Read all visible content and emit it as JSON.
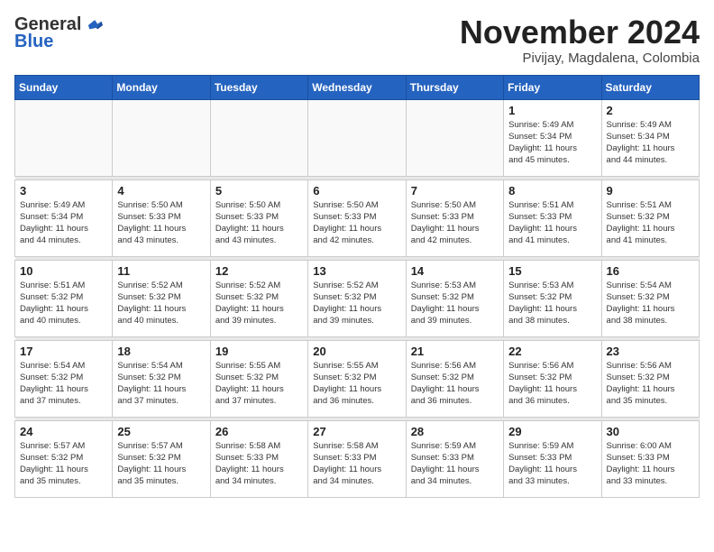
{
  "header": {
    "logo_general": "General",
    "logo_blue": "Blue",
    "month_title": "November 2024",
    "subtitle": "Pivijay, Magdalena, Colombia"
  },
  "days_of_week": [
    "Sunday",
    "Monday",
    "Tuesday",
    "Wednesday",
    "Thursday",
    "Friday",
    "Saturday"
  ],
  "weeks": [
    [
      {
        "day": "",
        "info": ""
      },
      {
        "day": "",
        "info": ""
      },
      {
        "day": "",
        "info": ""
      },
      {
        "day": "",
        "info": ""
      },
      {
        "day": "",
        "info": ""
      },
      {
        "day": "1",
        "info": "Sunrise: 5:49 AM\nSunset: 5:34 PM\nDaylight: 11 hours\nand 45 minutes."
      },
      {
        "day": "2",
        "info": "Sunrise: 5:49 AM\nSunset: 5:34 PM\nDaylight: 11 hours\nand 44 minutes."
      }
    ],
    [
      {
        "day": "3",
        "info": "Sunrise: 5:49 AM\nSunset: 5:34 PM\nDaylight: 11 hours\nand 44 minutes."
      },
      {
        "day": "4",
        "info": "Sunrise: 5:50 AM\nSunset: 5:33 PM\nDaylight: 11 hours\nand 43 minutes."
      },
      {
        "day": "5",
        "info": "Sunrise: 5:50 AM\nSunset: 5:33 PM\nDaylight: 11 hours\nand 43 minutes."
      },
      {
        "day": "6",
        "info": "Sunrise: 5:50 AM\nSunset: 5:33 PM\nDaylight: 11 hours\nand 42 minutes."
      },
      {
        "day": "7",
        "info": "Sunrise: 5:50 AM\nSunset: 5:33 PM\nDaylight: 11 hours\nand 42 minutes."
      },
      {
        "day": "8",
        "info": "Sunrise: 5:51 AM\nSunset: 5:33 PM\nDaylight: 11 hours\nand 41 minutes."
      },
      {
        "day": "9",
        "info": "Sunrise: 5:51 AM\nSunset: 5:32 PM\nDaylight: 11 hours\nand 41 minutes."
      }
    ],
    [
      {
        "day": "10",
        "info": "Sunrise: 5:51 AM\nSunset: 5:32 PM\nDaylight: 11 hours\nand 40 minutes."
      },
      {
        "day": "11",
        "info": "Sunrise: 5:52 AM\nSunset: 5:32 PM\nDaylight: 11 hours\nand 40 minutes."
      },
      {
        "day": "12",
        "info": "Sunrise: 5:52 AM\nSunset: 5:32 PM\nDaylight: 11 hours\nand 39 minutes."
      },
      {
        "day": "13",
        "info": "Sunrise: 5:52 AM\nSunset: 5:32 PM\nDaylight: 11 hours\nand 39 minutes."
      },
      {
        "day": "14",
        "info": "Sunrise: 5:53 AM\nSunset: 5:32 PM\nDaylight: 11 hours\nand 39 minutes."
      },
      {
        "day": "15",
        "info": "Sunrise: 5:53 AM\nSunset: 5:32 PM\nDaylight: 11 hours\nand 38 minutes."
      },
      {
        "day": "16",
        "info": "Sunrise: 5:54 AM\nSunset: 5:32 PM\nDaylight: 11 hours\nand 38 minutes."
      }
    ],
    [
      {
        "day": "17",
        "info": "Sunrise: 5:54 AM\nSunset: 5:32 PM\nDaylight: 11 hours\nand 37 minutes."
      },
      {
        "day": "18",
        "info": "Sunrise: 5:54 AM\nSunset: 5:32 PM\nDaylight: 11 hours\nand 37 minutes."
      },
      {
        "day": "19",
        "info": "Sunrise: 5:55 AM\nSunset: 5:32 PM\nDaylight: 11 hours\nand 37 minutes."
      },
      {
        "day": "20",
        "info": "Sunrise: 5:55 AM\nSunset: 5:32 PM\nDaylight: 11 hours\nand 36 minutes."
      },
      {
        "day": "21",
        "info": "Sunrise: 5:56 AM\nSunset: 5:32 PM\nDaylight: 11 hours\nand 36 minutes."
      },
      {
        "day": "22",
        "info": "Sunrise: 5:56 AM\nSunset: 5:32 PM\nDaylight: 11 hours\nand 36 minutes."
      },
      {
        "day": "23",
        "info": "Sunrise: 5:56 AM\nSunset: 5:32 PM\nDaylight: 11 hours\nand 35 minutes."
      }
    ],
    [
      {
        "day": "24",
        "info": "Sunrise: 5:57 AM\nSunset: 5:32 PM\nDaylight: 11 hours\nand 35 minutes."
      },
      {
        "day": "25",
        "info": "Sunrise: 5:57 AM\nSunset: 5:32 PM\nDaylight: 11 hours\nand 35 minutes."
      },
      {
        "day": "26",
        "info": "Sunrise: 5:58 AM\nSunset: 5:33 PM\nDaylight: 11 hours\nand 34 minutes."
      },
      {
        "day": "27",
        "info": "Sunrise: 5:58 AM\nSunset: 5:33 PM\nDaylight: 11 hours\nand 34 minutes."
      },
      {
        "day": "28",
        "info": "Sunrise: 5:59 AM\nSunset: 5:33 PM\nDaylight: 11 hours\nand 34 minutes."
      },
      {
        "day": "29",
        "info": "Sunrise: 5:59 AM\nSunset: 5:33 PM\nDaylight: 11 hours\nand 33 minutes."
      },
      {
        "day": "30",
        "info": "Sunrise: 6:00 AM\nSunset: 5:33 PM\nDaylight: 11 hours\nand 33 minutes."
      }
    ]
  ]
}
